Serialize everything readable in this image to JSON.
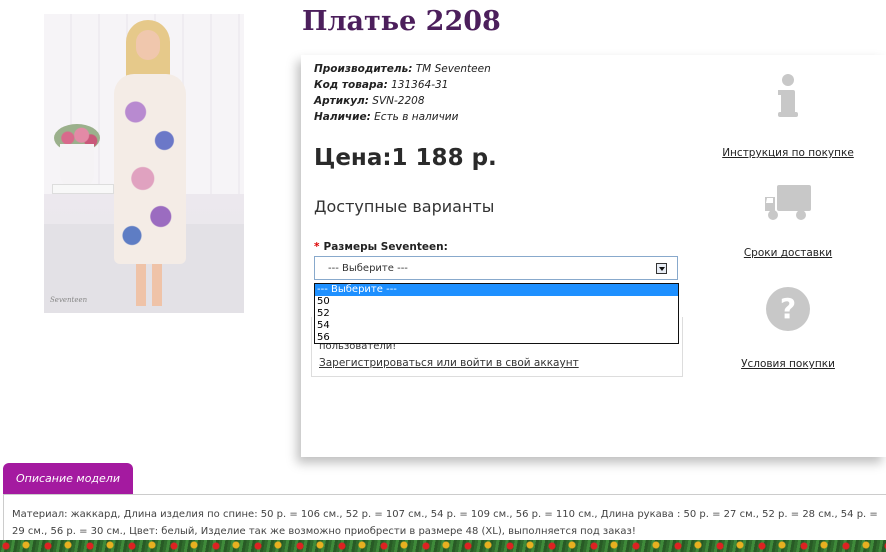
{
  "product": {
    "title": "Платье 2208",
    "photo_signature": "Seventeen"
  },
  "info": {
    "manufacturer_label": "Производитель:",
    "manufacturer_value": "ТМ Seventeen",
    "code_label": "Код товара:",
    "code_value": "131364-31",
    "article_label": "Артикул:",
    "article_value": "SVN-2208",
    "availability_label": "Наличие:",
    "availability_value": "Есть в наличии"
  },
  "price": {
    "label": "Цена:",
    "value": "1 188 р."
  },
  "variants": {
    "title": "Доступные варианты",
    "required_mark": "*",
    "size_label": "Размеры Seventeen:",
    "selected": "--- Выберите ---",
    "options": [
      "--- Выберите ---",
      "50",
      "52",
      "54",
      "56"
    ]
  },
  "account": {
    "notice_fragment": "пользователи!",
    "register_link": "Зарегистрироваться или войти в свой аккаунт"
  },
  "sidebar": {
    "items": [
      {
        "icon": "info-icon",
        "label": "Инструкция по покупке"
      },
      {
        "icon": "truck-icon",
        "label": "Сроки доставки"
      },
      {
        "icon": "question-icon",
        "label": "Условия покупки"
      }
    ]
  },
  "description": {
    "tab_label": "Описание модели",
    "text": "Материал: жаккард, Длина изделия по спине: 50 р. = 106 см., 52 р. = 107 см., 54 р. = 109 см., 56 р. = 110 см., Длина рукава : 50 р. = 27 см., 52 р. = 28 см., 54 р. = 29 см., 56 р. = 30 см., Цвет: белый, Изделие так же возможно приобрести в размере 48 (XL), выполняется под заказ!"
  },
  "colors": {
    "title": "#4c1f5c",
    "tab": "#a41aa0",
    "selected_option": "#1e90ff",
    "icon_gray": "#c8c8c8"
  }
}
